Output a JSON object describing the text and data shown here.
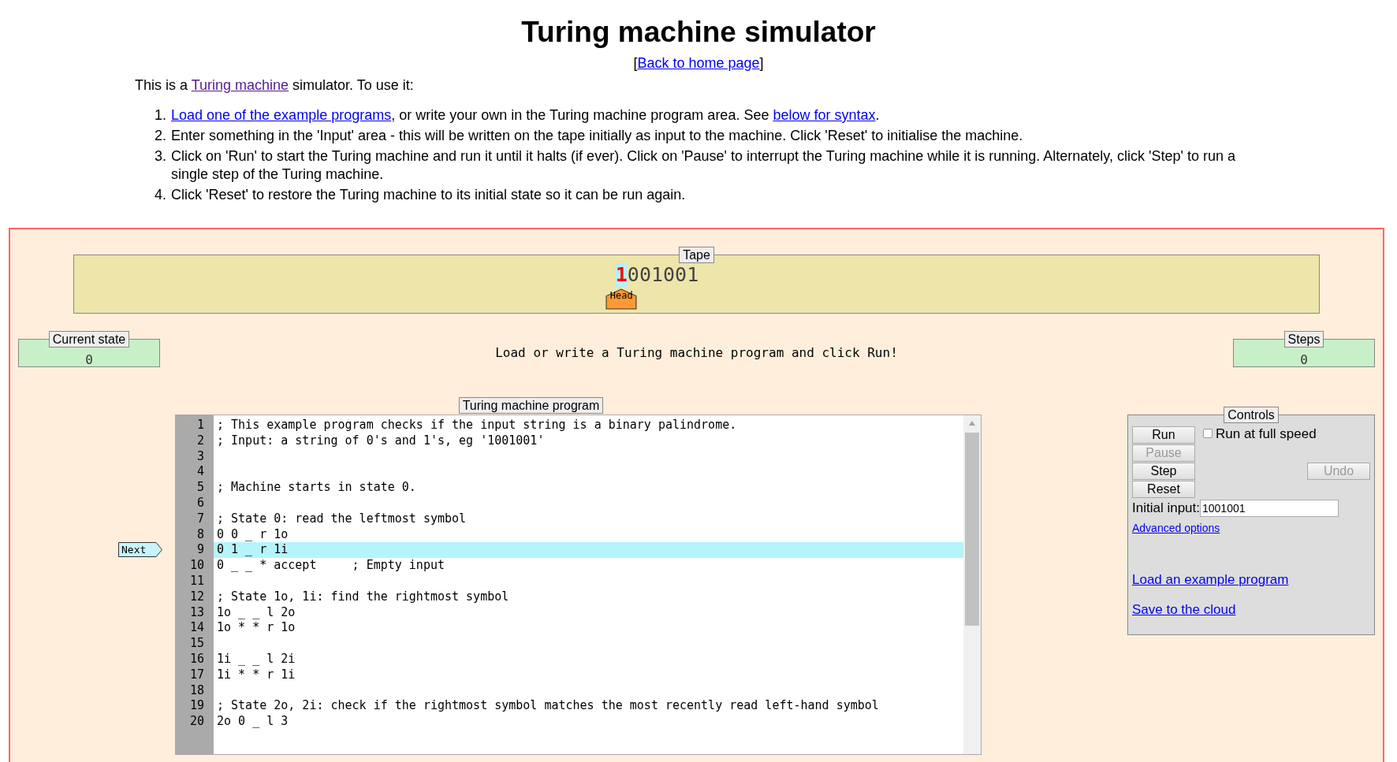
{
  "header": {
    "title": "Turing machine simulator",
    "back_link": {
      "open": "[",
      "label": "Back to home page",
      "close": "]"
    }
  },
  "intro": [
    {
      "kind": "text",
      "text": "This is a "
    },
    {
      "kind": "link",
      "text": "Turing machine",
      "visited": true
    },
    {
      "kind": "text",
      "text": " simulator. To use it:"
    }
  ],
  "steps_list": [
    {
      "number": "1.",
      "parts": [
        {
          "kind": "link",
          "text": "Load one of the example programs",
          "visited": false
        },
        {
          "kind": "text",
          "text": ", or write your own in the Turing machine program area. See "
        },
        {
          "kind": "link",
          "text": "below for syntax",
          "visited": false
        },
        {
          "kind": "text",
          "text": "."
        }
      ]
    },
    {
      "number": "2.",
      "parts": [
        {
          "kind": "text",
          "text": "Enter something in the 'Input' area - this will be written on the tape initially as input to the machine. Click 'Reset' to initialise the machine."
        }
      ]
    },
    {
      "number": "3.",
      "parts": [
        {
          "kind": "text",
          "text": "Click on 'Run' to start the Turing machine and run it until it halts (if ever). Click on 'Pause' to interrupt the Turing machine while it is running. Alternately, click 'Step' to run a single step of the Turing machine."
        }
      ]
    },
    {
      "number": "4.",
      "parts": [
        {
          "kind": "text",
          "text": "Click 'Reset' to restore the Turing machine to its initial state so it can be run again."
        }
      ]
    }
  ],
  "tape": {
    "legend": "Tape",
    "head_label": "Head",
    "cells": [
      {
        "symbol": "1",
        "head": true
      },
      {
        "symbol": "0",
        "head": false
      },
      {
        "symbol": "0",
        "head": false
      },
      {
        "symbol": "1",
        "head": false
      },
      {
        "symbol": "0",
        "head": false
      },
      {
        "symbol": "0",
        "head": false
      },
      {
        "symbol": "1",
        "head": false
      }
    ]
  },
  "current_state": {
    "legend": "Current state",
    "value": "0"
  },
  "message": "Load or write a Turing machine program and click Run!",
  "steps": {
    "legend": "Steps",
    "value": "0"
  },
  "program": {
    "legend": "Turing machine program",
    "next_label": "Next",
    "lines": [
      {
        "number": "1",
        "text": "; This example program checks if the input string is a binary palindrome.",
        "current": false
      },
      {
        "number": "2",
        "text": "; Input: a string of 0's and 1's, eg '1001001'",
        "current": false
      },
      {
        "number": "3",
        "current": false
      },
      {
        "number": "4",
        "current": false
      },
      {
        "number": "5",
        "text": "; Machine starts in state 0.",
        "current": false
      },
      {
        "number": "6",
        "current": false
      },
      {
        "number": "7",
        "text": "; State 0: read the leftmost symbol",
        "current": false
      },
      {
        "number": "8",
        "text": "0 0 _ r 1o",
        "current": false
      },
      {
        "number": "9",
        "text": "0 1 _ r 1i",
        "current": true
      },
      {
        "number": "10",
        "text": "0 _ _ * accept     ; Empty input",
        "current": false
      },
      {
        "number": "11",
        "current": false
      },
      {
        "number": "12",
        "text": "; State 1o, 1i: find the rightmost symbol",
        "current": false
      },
      {
        "number": "13",
        "text": "1o _ _ l 2o",
        "current": false
      },
      {
        "number": "14",
        "text": "1o * * r 1o",
        "current": false
      },
      {
        "number": "15",
        "current": false
      },
      {
        "number": "16",
        "text": "1i _ _ l 2i",
        "current": false
      },
      {
        "number": "17",
        "text": "1i * * r 1i",
        "current": false
      },
      {
        "number": "18",
        "current": false
      },
      {
        "number": "19",
        "text": "; State 2o, 2i: check if the rightmost symbol matches the most recently read left-hand symbol",
        "current": false
      },
      {
        "number": "20",
        "text": "2o 0 _ l 3",
        "current": false
      }
    ]
  },
  "controls": {
    "legend": "Controls",
    "buttons": [
      {
        "label": "Run",
        "disabled": false
      },
      {
        "label": "Pause",
        "disabled": true
      },
      {
        "label": "Step",
        "disabled": false
      },
      {
        "label": "Reset",
        "disabled": false
      }
    ],
    "full_speed": {
      "label": "Run at full speed",
      "checked": false
    },
    "undo": {
      "label": "Undo",
      "disabled": true
    },
    "initial_input": {
      "label": "Initial input:",
      "value": "1001001"
    },
    "advanced_link": "Advanced options",
    "links": [
      "Load an example program",
      "Save to the cloud"
    ]
  }
}
